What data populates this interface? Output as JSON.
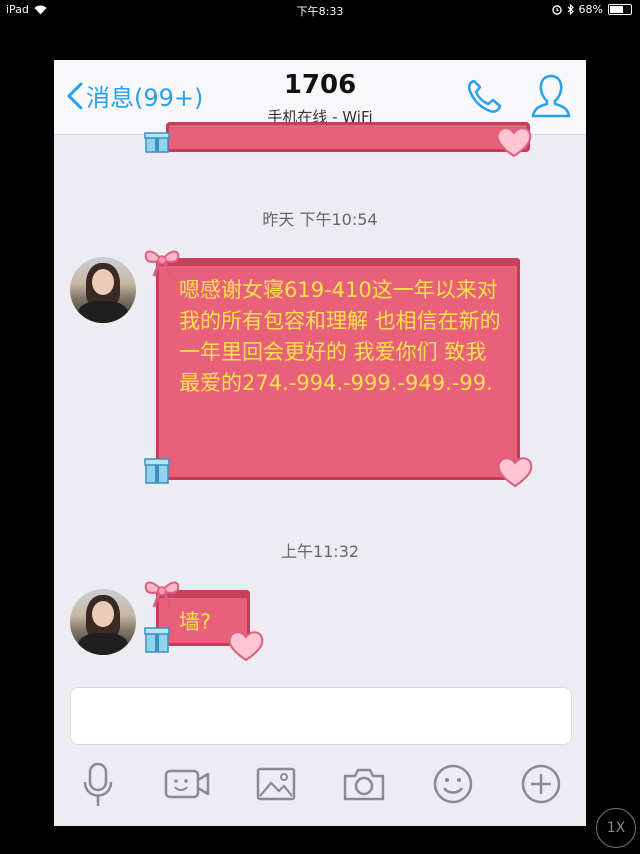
{
  "status_bar": {
    "device": "iPad",
    "time": "下午8:33",
    "battery": "68%"
  },
  "header": {
    "back_label": "消息(99+)",
    "title": "1706",
    "subtitle": "手机在线 - WiFi"
  },
  "messages": [
    {
      "timestamp": "昨天 下午10:54",
      "text": "嗯感谢女寝619-410这一年以来对我的所有包容和理解 也相信在新的一年里回会更好的 我爱你们 致我最爱的274.-994.-999.-949.-99."
    },
    {
      "timestamp": "上午11:32",
      "text": "墙?"
    }
  ],
  "toolbar": {
    "icons": [
      "microphone-icon",
      "video-call-icon",
      "image-icon",
      "camera-icon",
      "emoji-icon",
      "plus-icon"
    ]
  },
  "overlay": {
    "zoom_label": "1X"
  },
  "colors": {
    "accent": "#27a0ee",
    "bubble_fill": "#e8607a",
    "bubble_text": "#ffe34a"
  }
}
